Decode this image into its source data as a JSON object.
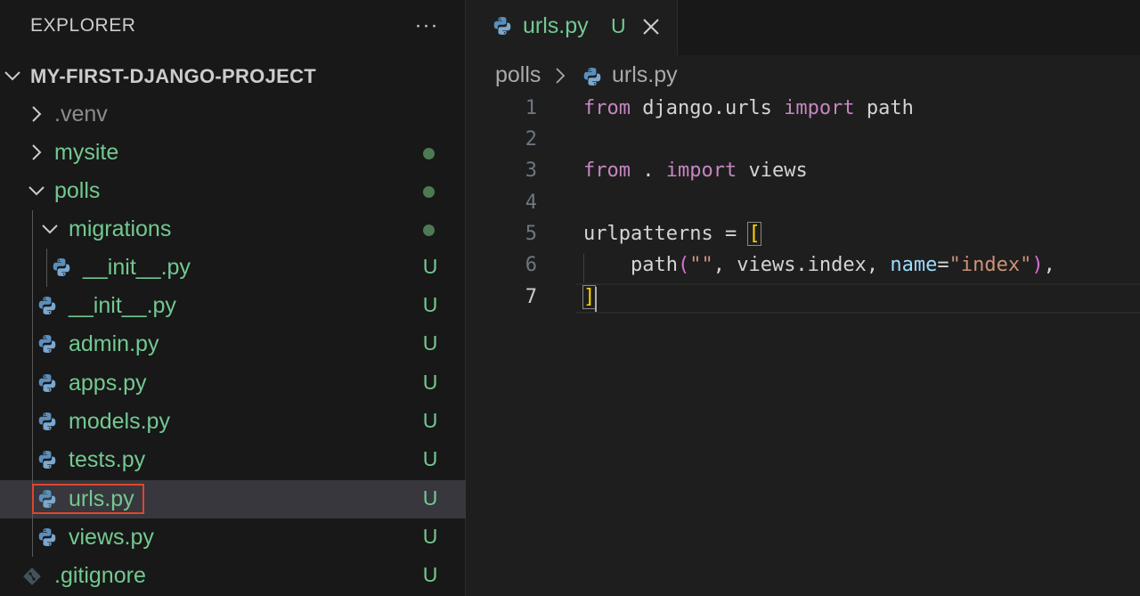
{
  "explorer": {
    "title": "EXPLORER",
    "more_actions": "···",
    "project": "MY-FIRST-DJANGO-PROJECT",
    "items": [
      {
        "label": ".venv",
        "kind": "folder",
        "expanded": false,
        "status": "",
        "color": "#8c8c8c"
      },
      {
        "label": "mysite",
        "kind": "folder",
        "expanded": false,
        "status": "dot",
        "color": "#73c991"
      },
      {
        "label": "polls",
        "kind": "folder",
        "expanded": true,
        "status": "dot",
        "color": "#73c991"
      },
      {
        "label": "migrations",
        "kind": "folder",
        "expanded": true,
        "status": "dot",
        "color": "#73c991"
      },
      {
        "label": "__init__.py",
        "kind": "file",
        "status": "U",
        "color": "#73c991"
      },
      {
        "label": "__init__.py",
        "kind": "file",
        "status": "U",
        "color": "#73c991"
      },
      {
        "label": "admin.py",
        "kind": "file",
        "status": "U",
        "color": "#73c991"
      },
      {
        "label": "apps.py",
        "kind": "file",
        "status": "U",
        "color": "#73c991"
      },
      {
        "label": "models.py",
        "kind": "file",
        "status": "U",
        "color": "#73c991"
      },
      {
        "label": "tests.py",
        "kind": "file",
        "status": "U",
        "color": "#73c991"
      },
      {
        "label": "urls.py",
        "kind": "file",
        "status": "U",
        "color": "#73c991",
        "selected": true
      },
      {
        "label": "views.py",
        "kind": "file",
        "status": "U",
        "color": "#73c991"
      },
      {
        "label": ".gitignore",
        "kind": "git",
        "status": "U",
        "color": "#73c991"
      }
    ]
  },
  "tab": {
    "label": "urls.py",
    "status": "U"
  },
  "breadcrumb": {
    "folder": "polls",
    "file": "urls.py"
  },
  "code": {
    "line_numbers": [
      "1",
      "2",
      "3",
      "4",
      "5",
      "6",
      "7"
    ],
    "lines": [
      {
        "t1": "from",
        "t2": " django.urls ",
        "t3": "import",
        "t4": " path"
      },
      {},
      {
        "t1": "from",
        "t2": " . ",
        "t3": "import",
        "t4": " views"
      },
      {},
      {
        "t1": "urlpatterns = ",
        "t2": "["
      },
      {
        "t1": "    path",
        "t2": "(",
        "t3": "\"\"",
        "t4": ", views.index, ",
        "t5": "name",
        "t6": "=",
        "t7": "\"index\"",
        "t8": ")",
        "t9": ","
      },
      {
        "t1": "]"
      }
    ]
  },
  "colors": {
    "accent_untracked": "#73c991",
    "selection_border": "#e0452d",
    "keyword": "#c586c0",
    "string": "#ce9178",
    "bracket": "#ffd700"
  }
}
